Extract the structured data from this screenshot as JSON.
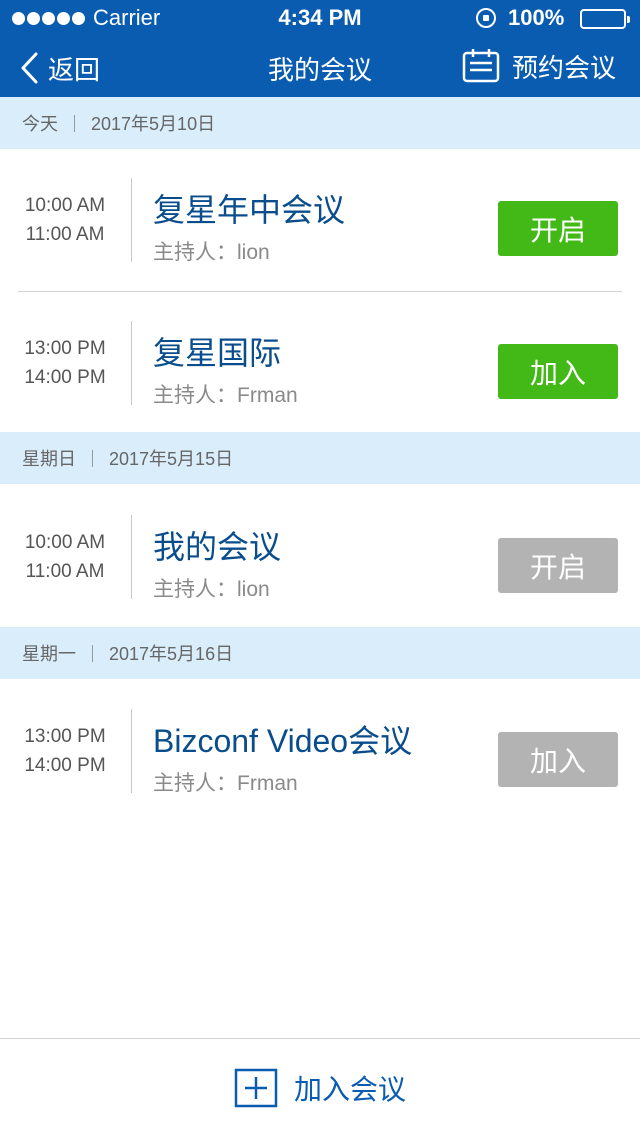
{
  "status_bar": {
    "carrier": "Carrier",
    "time": "4:34 PM",
    "battery": "100%"
  },
  "nav": {
    "back_label": "返回",
    "title": "我的会议",
    "book_label": "预约会议"
  },
  "groups": [
    {
      "day": "今天",
      "date": "2017年5月10日"
    },
    {
      "day": "星期日",
      "date": "2017年5月15日"
    },
    {
      "day": "星期一",
      "date": "2017年5月16日"
    }
  ],
  "meetings": [
    {
      "start": "10:00 AM",
      "end": "11:00 AM",
      "title": "复星年中会议",
      "host": "主持人：lion",
      "action": "开启",
      "action_state": "active"
    },
    {
      "start": "13:00 PM",
      "end": "14:00 PM",
      "title": "复星国际",
      "host": "主持人：Frman",
      "action": "加入",
      "action_state": "active"
    },
    {
      "start": "10:00 AM",
      "end": "11:00 AM",
      "title": "我的会议",
      "host": "主持人：lion",
      "action": "开启",
      "action_state": "disabled"
    },
    {
      "start": "13:00 PM",
      "end": "14:00 PM",
      "title": "Bizconf Video会议",
      "host": "主持人：Frman",
      "action": "加入",
      "action_state": "disabled"
    }
  ],
  "bottom_bar": {
    "join_label": "加入会议"
  },
  "colors": {
    "brand_blue": "#0a5cb0",
    "title_blue": "#0a4d8c",
    "header_band": "#d9edfa",
    "action_active": "#43b918",
    "action_disabled": "#b3b3b3"
  },
  "icons": {
    "signal": "signal-dots-icon",
    "rotation_lock": "rotation-lock-icon",
    "battery": "battery-icon",
    "back": "chevron-left-icon",
    "book": "calendar-icon",
    "join": "plus-square-icon"
  }
}
